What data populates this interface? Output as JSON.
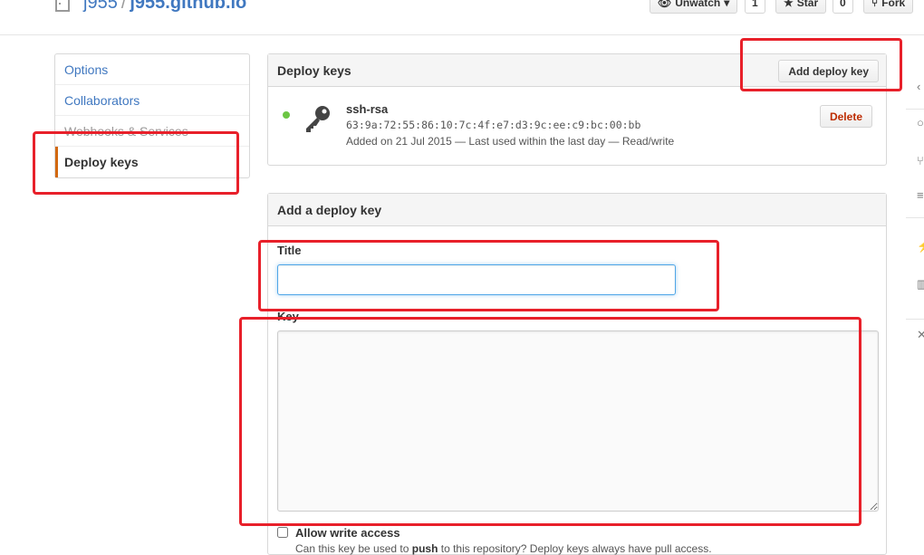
{
  "header": {
    "owner": "j955",
    "separator": "/",
    "repo": "j955.github.io",
    "unwatch_label": "Unwatch",
    "watch_count": "1",
    "star_label": "Star",
    "star_count": "0",
    "fork_label": "Fork"
  },
  "menu": {
    "items": [
      {
        "label": "Options"
      },
      {
        "label": "Collaborators"
      },
      {
        "label": "Webhooks & Services"
      },
      {
        "label": "Deploy keys"
      }
    ]
  },
  "deploy_keys": {
    "heading": "Deploy keys",
    "add_button": "Add deploy key",
    "key": {
      "name": "ssh-rsa",
      "fingerprint": "63:9a:72:55:86:10:7c:4f:e7:d3:9c:ee:c9:bc:00:bb",
      "meta": "Added on 21 Jul 2015 — Last used within the last day — Read/write",
      "delete_label": "Delete",
      "status_color": "#6cc644"
    }
  },
  "add_form": {
    "heading": "Add a deploy key",
    "title_label": "Title",
    "title_value": "",
    "key_label": "Key",
    "key_value": "",
    "write_label": "Allow write access",
    "help_prefix": "Can this key be used to ",
    "help_bold": "push",
    "help_suffix": " to this repository? Deploy keys always have pull access."
  },
  "colors": {
    "link": "#4078c0",
    "annotation": "#e8202a",
    "danger": "#bd2c00",
    "selected_accent": "#d26911"
  }
}
